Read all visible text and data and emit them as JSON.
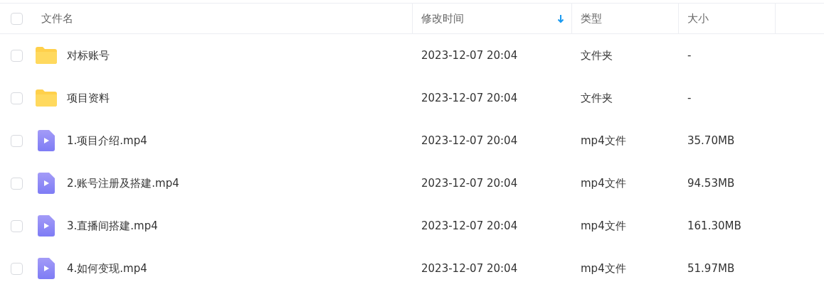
{
  "header": {
    "select_all_checked": false,
    "columns": [
      {
        "label": "文件名",
        "sorted": false
      },
      {
        "label": "修改时间",
        "sorted": true
      },
      {
        "label": "类型",
        "sorted": false
      },
      {
        "label": "大小",
        "sorted": false
      }
    ]
  },
  "rows": [
    {
      "kind": "folder",
      "checked": false,
      "name": "对标账号",
      "modified": "2023-12-07 20:04",
      "type": "文件夹",
      "size": "-"
    },
    {
      "kind": "folder",
      "checked": false,
      "name": "项目资料",
      "modified": "2023-12-07 20:04",
      "type": "文件夹",
      "size": "-"
    },
    {
      "kind": "video",
      "checked": false,
      "name": "1.项目介绍.mp4",
      "modified": "2023-12-07 20:04",
      "type": "mp4文件",
      "size": "35.70MB"
    },
    {
      "kind": "video",
      "checked": false,
      "name": "2.账号注册及搭建.mp4",
      "modified": "2023-12-07 20:04",
      "type": "mp4文件",
      "size": "94.53MB"
    },
    {
      "kind": "video",
      "checked": false,
      "name": "3.直播间搭建.mp4",
      "modified": "2023-12-07 20:04",
      "type": "mp4文件",
      "size": "161.30MB"
    },
    {
      "kind": "video",
      "checked": false,
      "name": "4.如何变现.mp4",
      "modified": "2023-12-07 20:04",
      "type": "mp4文件",
      "size": "51.97MB"
    }
  ]
}
